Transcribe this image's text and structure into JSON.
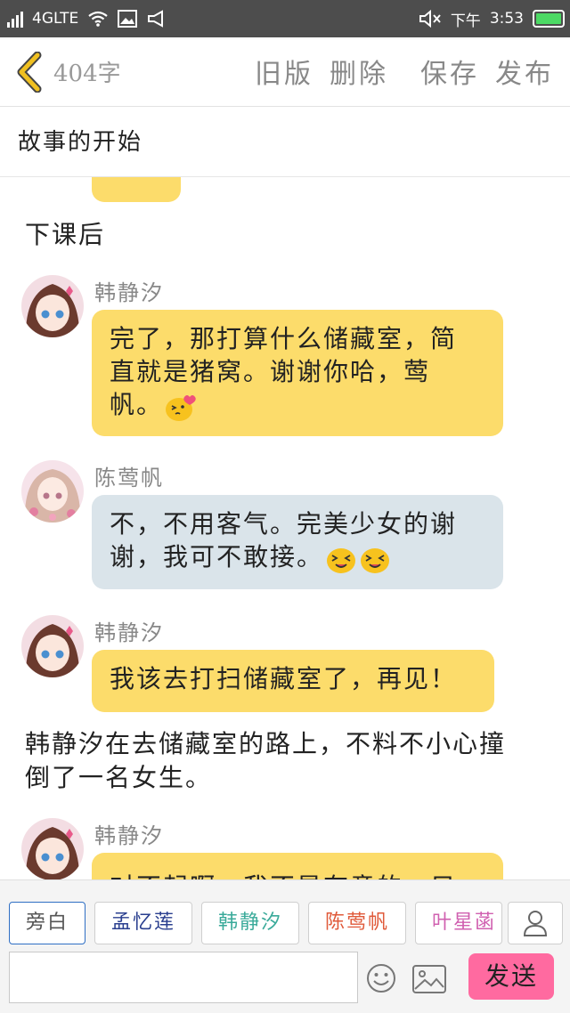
{
  "status_bar": {
    "network": "4GLTE",
    "time_label": "下午",
    "time": "3:53",
    "icons": [
      "signal-icon",
      "wifi-icon",
      "image-notification-icon",
      "megaphone-icon",
      "mute-icon",
      "battery-icon"
    ]
  },
  "header": {
    "word_count": "404字",
    "actions": [
      "旧版",
      "删除",
      "保存",
      "发布"
    ]
  },
  "story": {
    "title": "故事的开始"
  },
  "content": {
    "narration_1": "下课后",
    "messages": [
      {
        "speaker": "韩静汐",
        "lines": [
          "完了，那打算什么储藏室，简",
          "直就是猪窝。谢谢你哈，莺",
          "帆。"
        ],
        "style": "yellow",
        "emoji": [
          "kiss"
        ]
      },
      {
        "speaker": "陈莺帆",
        "lines": [
          "不，不用客气。完美少女的谢",
          "谢，我可不敢接。"
        ],
        "style": "gray",
        "emoji": [
          "grin",
          "grin"
        ]
      },
      {
        "speaker": "韩静汐",
        "lines": [
          "我该去打扫储藏室了，再见！"
        ],
        "style": "yellow",
        "emoji": []
      }
    ],
    "narration_2_lines": [
      "韩静汐在去储藏室的路上，不料不小心撞",
      "倒了一名女生。"
    ],
    "partial_message": {
      "speaker": "韩静汐",
      "text": "对不起啊，我不是有意的，只"
    }
  },
  "bottom_bar": {
    "characters": [
      {
        "name": "旁白",
        "color": "#555555",
        "selected": true
      },
      {
        "name": "孟忆莲",
        "color": "#2a3f8f",
        "selected": false
      },
      {
        "name": "韩静汐",
        "color": "#3aaa9a",
        "selected": false
      },
      {
        "name": "陈莺帆",
        "color": "#e05a3a",
        "selected": false
      },
      {
        "name": "叶星菡",
        "color": "#d060b0",
        "selected": false
      }
    ],
    "input_value": "",
    "send_label": "发送"
  },
  "colors": {
    "bubble_yellow": "#fcdc6b",
    "bubble_gray": "#dae4ea",
    "send_button": "#ff6aa0",
    "back_chevron": "#f0c020"
  }
}
